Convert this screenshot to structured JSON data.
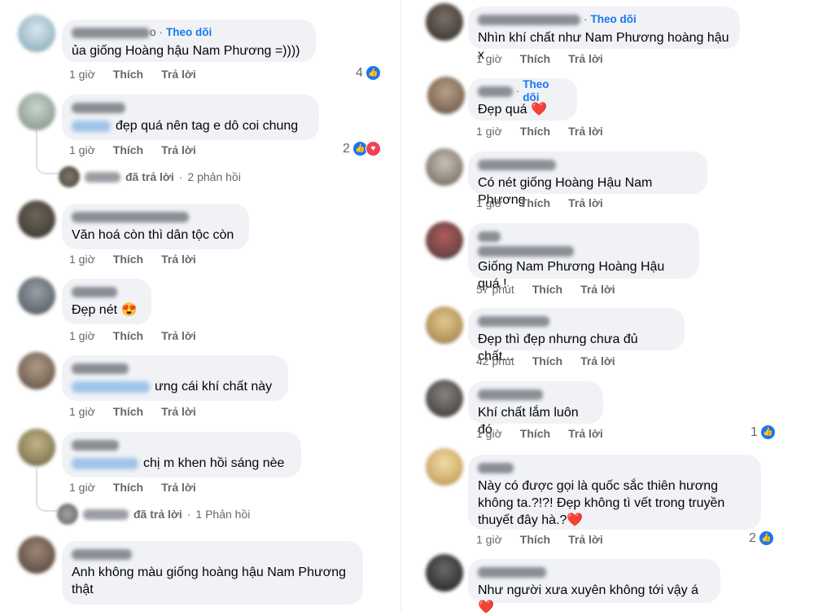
{
  "left": [
    {
      "name_suffix": "o",
      "follow": "Theo dõi",
      "text": "ủa giống Hoàng hậu Nam Phương =))))",
      "time": "1 giờ",
      "like": "Thích",
      "reply": "Trả lời",
      "react_count": "4",
      "react": "like"
    },
    {
      "tag_prefix": "",
      "text": "đẹp quá nên tag e dô coi chung",
      "time": "1 giờ",
      "like": "Thích",
      "reply": "Trả lời",
      "react_count": "2",
      "react": "like-heart",
      "reply_summary": {
        "action": "đã trả lời",
        "count": "2 phản hồi"
      }
    },
    {
      "text": "Văn hoá còn thì dân tộc còn",
      "time": "1 giờ",
      "like": "Thích",
      "reply": "Trả lời"
    },
    {
      "text": "Đẹp nét",
      "emoji": "😍",
      "time": "1 giờ",
      "like": "Thích",
      "reply": "Trả lời"
    },
    {
      "text": "ưng cái khí chất này",
      "time": "1 giờ",
      "like": "Thích",
      "reply": "Trả lời"
    },
    {
      "text": "chị m khen hồi sáng nèe",
      "time": "1 giờ",
      "like": "Thích",
      "reply": "Trả lời",
      "reply_summary": {
        "action": "đã trả lời",
        "count": "1 Phản hồi"
      }
    },
    {
      "text": "Anh không màu giống hoàng hậu Nam Phương thật"
    }
  ],
  "right": [
    {
      "follow": "Theo dõi",
      "text": "Nhìn khí chất như Nam Phương hoàng hậu x",
      "time": "1 giờ",
      "like": "Thích",
      "reply": "Trả lời"
    },
    {
      "follow": "Theo dõi",
      "text": "Đẹp quá",
      "emoji": "❤️",
      "time": "1 giờ",
      "like": "Thích",
      "reply": "Trả lời"
    },
    {
      "text": "Có nét giống Hoàng Hậu Nam Phương",
      "time": "1 giờ",
      "like": "Thích",
      "reply": "Trả lời"
    },
    {
      "text": "Giống Nam Phương Hoàng Hậu quá !",
      "time": "57 phút",
      "like": "Thích",
      "reply": "Trả lời"
    },
    {
      "text": "Đẹp thì đẹp nhưng chưa đủ chất...",
      "time": "42 phút",
      "like": "Thích",
      "reply": "Trả lời"
    },
    {
      "text": "Khí chất lắm luôn đó",
      "time": "1 giờ",
      "like": "Thích",
      "reply": "Trả lời",
      "react_count": "1",
      "react": "like"
    },
    {
      "text": "Này có được gọi là quốc sắc thiên hương không ta.?!?! Đẹp không tì vết trong truyền thuyết đây hà.?",
      "emoji": "❤️",
      "time": "1 giờ",
      "like": "Thích",
      "reply": "Trả lời",
      "react_count": "2",
      "react": "like"
    },
    {
      "text": "Như người xưa xuyên không tới vậy á",
      "emoji": "❤️"
    }
  ],
  "colors": {
    "follow": "#1877f2",
    "bubble": "#f0f2f5",
    "meta": "#65676b",
    "like": "#1877f2",
    "heart": "#f33e58"
  }
}
